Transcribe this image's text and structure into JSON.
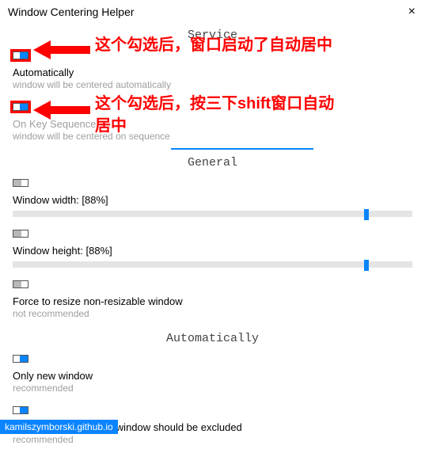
{
  "window": {
    "title": "Window Centering Helper",
    "close": "×"
  },
  "annotations": {
    "a1": "这个勾选后，窗口启动了自动居中",
    "a2_line1": "这个勾选后，按三下shift窗口自动",
    "a2_line2": "居中"
  },
  "service": {
    "heading": "Service",
    "automatically": {
      "title": "Automatically",
      "sub": "window will be centered automatically"
    },
    "onkey": {
      "title": "On Key Sequence",
      "sub": "window will be centered on sequence"
    }
  },
  "general": {
    "heading": "General",
    "width_label": "Window width: [88%]",
    "height_label": "Window height: [88%]",
    "force_title": "Force to resize non-resizable window",
    "force_sub": "not recommended"
  },
  "auto": {
    "heading": "Automatically",
    "onlynew_title": "Only new window",
    "onlynew_sub": "recommended",
    "help_title": "Help me decide which window should be excluded",
    "help_sub": "recommended"
  },
  "footer": {
    "link": "kamilszymborski.github.io"
  }
}
